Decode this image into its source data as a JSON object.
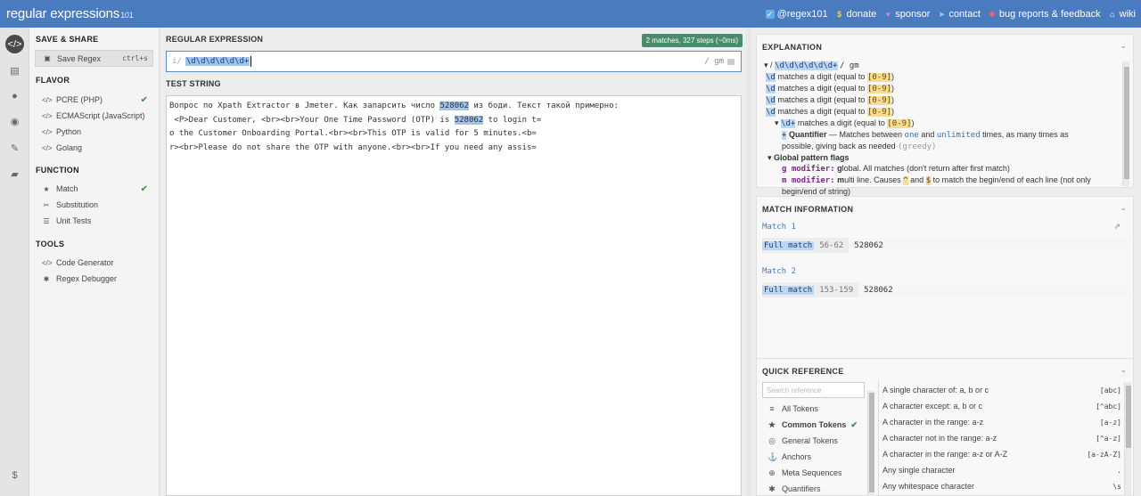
{
  "topbar": {
    "logo_main": "regular expressions",
    "logo_tld": "101",
    "links": [
      {
        "label": "@regex101",
        "icon": "twitter-icon",
        "color": "#5fb0ea"
      },
      {
        "label": "donate",
        "icon": "dollar-icon",
        "color": "#f2c94c"
      },
      {
        "label": "sponsor",
        "icon": "heart-icon",
        "color": "#e37fd0"
      },
      {
        "label": "contact",
        "icon": "paper-plane-icon",
        "color": "#8fd1ff"
      },
      {
        "label": "bug reports & feedback",
        "icon": "bug-icon",
        "color": "#e66"
      },
      {
        "label": "wiki",
        "icon": "bank-icon",
        "color": "#fff"
      }
    ]
  },
  "sidebar": {
    "save_share_heading": "SAVE & SHARE",
    "save_label": "Save Regex",
    "save_shortcut": "ctrl+s",
    "flavor_heading": "FLAVOR",
    "flavors": [
      "PCRE (PHP)",
      "ECMAScript (JavaScript)",
      "Python",
      "Golang"
    ],
    "function_heading": "FUNCTION",
    "functions": [
      "Match",
      "Substitution",
      "Unit Tests"
    ],
    "tools_heading": "TOOLS",
    "tools": [
      "Code Generator",
      "Regex Debugger"
    ]
  },
  "editor": {
    "regex_label": "REGULAR EXPRESSION",
    "matches_badge": "2 matches, 327 steps (~0ms)",
    "delimiter_open": "i/",
    "pattern": "\\d\\d\\d\\d\\d\\d+",
    "flags": "/ gm",
    "test_label": "TEST STRING",
    "test_lines": [
      {
        "pre": "Вопрос по Xpath Extractor в Jmeter. Как запарсить число ",
        "match": "528062",
        "post": " из боди. Текст такой примерно:"
      },
      {
        "pre": " <P>Dear Customer, <br><br>Your One Time Password (OTP) is ",
        "match": "528062",
        "post": " to login t="
      },
      {
        "pre": "o the Customer Onboarding Portal.<br><br>This OTP is valid for 5 minutes.<b=",
        "match": "",
        "post": ""
      },
      {
        "pre": "r><br>Please do not share the OTP with anyone.<br><br>If you need any assis=",
        "match": "",
        "post": ""
      }
    ]
  },
  "explanation": {
    "title": "EXPLANATION",
    "root_delim_open": "/",
    "root_pattern": "\\d\\d\\d\\d\\d\\d+",
    "root_delim_close": "/ gm",
    "digit_token": "\\d",
    "digit_text": "matches a digit (equal to",
    "digit_class": "[0-9]",
    "plus_token": "\\d+",
    "quant_symbol": "+",
    "quant_label": "Quantifier",
    "quant_text_1": "— Matches between",
    "quant_one": "one",
    "quant_and": "and",
    "quant_unlimited": "unlimited",
    "quant_text_2": "times, as many times as",
    "quant_text_3": "possible, giving back as needed",
    "quant_greedy": "(greedy)",
    "flags_heading": "Global pattern flags",
    "g_mod": "g modifier:",
    "g_bold": "g",
    "g_rest": "lobal. All matches (don't return after first match)",
    "m_mod": "m modifier:",
    "m_bold": "m",
    "m_rest_1": "ulti line. Causes",
    "m_caret": "^",
    "m_and": "and",
    "m_dollar": "$",
    "m_rest_2": "to match the begin/end of each line (not only",
    "m_rest_3": "begin/end of string)"
  },
  "match_info": {
    "title": "MATCH INFORMATION",
    "matches": [
      {
        "label": "Match 1",
        "full": "Full match",
        "range": "56-62",
        "value": "528062"
      },
      {
        "label": "Match 2",
        "full": "Full match",
        "range": "153-159",
        "value": "528062"
      }
    ]
  },
  "quick_ref": {
    "title": "QUICK REFERENCE",
    "search_placeholder": "Search reference",
    "categories": [
      {
        "label": "All Tokens",
        "icon": "database-icon"
      },
      {
        "label": "Common Tokens",
        "icon": "star-icon",
        "active": true
      },
      {
        "label": "General Tokens",
        "icon": "circle-dot-icon"
      },
      {
        "label": "Anchors",
        "icon": "anchor-icon"
      },
      {
        "label": "Meta Sequences",
        "icon": "globe-icon"
      },
      {
        "label": "Quantifiers",
        "icon": "asterisk-icon"
      }
    ],
    "refs": [
      {
        "desc": "A single character of: a, b or c",
        "code": "[abc]"
      },
      {
        "desc": "A character except: a, b or c",
        "code": "[^abc]"
      },
      {
        "desc": "A character in the range: a-z",
        "code": "[a-z]"
      },
      {
        "desc": "A character not in the range: a-z",
        "code": "[^a-z]"
      },
      {
        "desc": "A character in the range: a-z or A-Z",
        "code": "[a-zA-Z]"
      },
      {
        "desc": "Any single character",
        "code": "."
      },
      {
        "desc": "Any whitespace character",
        "code": "\\s"
      }
    ]
  }
}
